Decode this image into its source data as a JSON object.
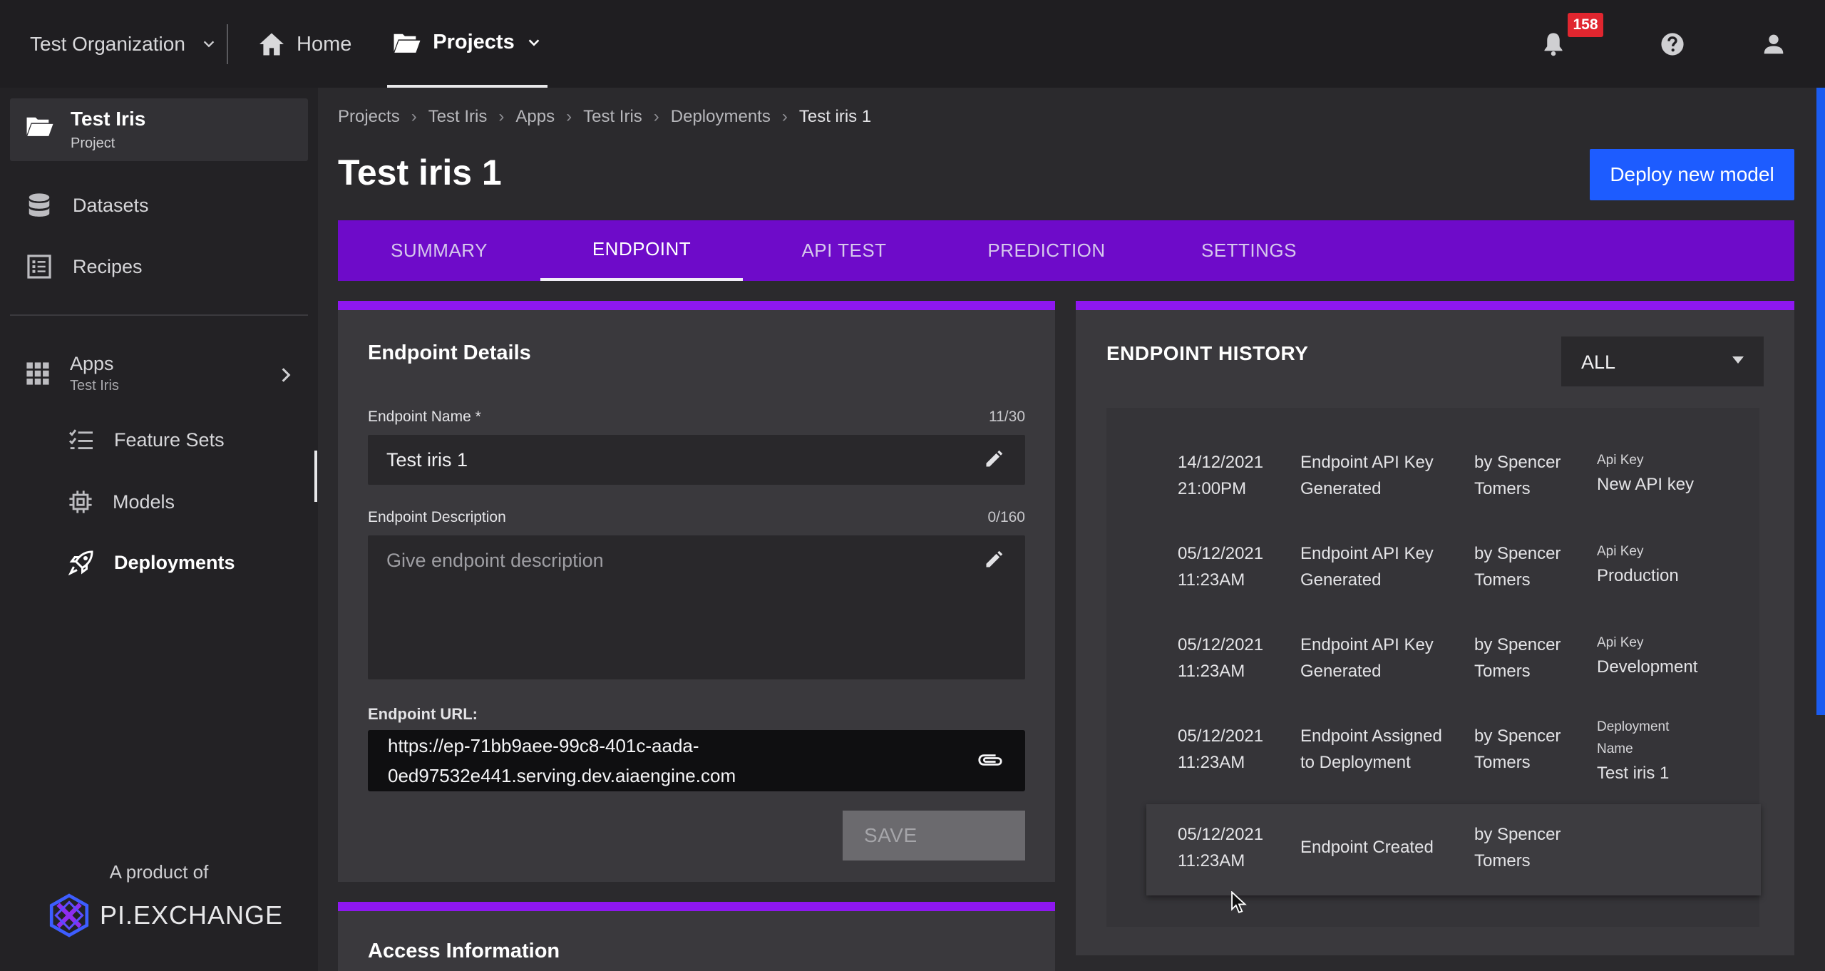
{
  "topbar": {
    "org_name": "Test Organization",
    "home_label": "Home",
    "projects_label": "Projects",
    "notification_count": "158"
  },
  "sidebar": {
    "project_title": "Test Iris",
    "project_sub": "Project",
    "datasets": "Datasets",
    "recipes": "Recipes",
    "apps_title": "Apps",
    "apps_sub": "Test Iris",
    "feature_sets": "Feature Sets",
    "models": "Models",
    "deployments": "Deployments",
    "product_of": "A product of",
    "brand": "PI.EXCHANGE"
  },
  "breadcrumb": [
    "Projects",
    "Test Iris",
    "Apps",
    "Test Iris",
    "Deployments",
    "Test iris 1"
  ],
  "page": {
    "title": "Test iris 1",
    "deploy_button": "Deploy new model"
  },
  "tabs": [
    "SUMMARY",
    "ENDPOINT",
    "API TEST",
    "PREDICTION",
    "SETTINGS"
  ],
  "endpoint": {
    "card_title": "Endpoint Details",
    "name_label": "Endpoint Name *",
    "name_count": "11/30",
    "name_value": "Test iris 1",
    "desc_label": "Endpoint Description",
    "desc_count": "0/160",
    "desc_placeholder": "Give endpoint description",
    "url_label": "Endpoint URL:",
    "url_line1": "https://ep-71bb9aee-99c8-401c-aada-",
    "url_line2": "0ed97532e441.serving.dev.aiaengine.com",
    "save_label": "SAVE"
  },
  "access": {
    "card_title": "Access Information"
  },
  "history": {
    "title": "ENDPOINT HISTORY",
    "filter_value": "ALL",
    "rows": [
      {
        "date": "14/12/2021",
        "time": "21:00PM",
        "event1": "Endpoint API Key",
        "event2": "Generated",
        "by1": "by Spencer",
        "by2": "Tomers",
        "k1": "Api Key",
        "k2": "",
        "v": "New API key"
      },
      {
        "date": "05/12/2021",
        "time": "11:23AM",
        "event1": "Endpoint API Key",
        "event2": "Generated",
        "by1": "by Spencer",
        "by2": "Tomers",
        "k1": "Api Key",
        "k2": "",
        "v": "Production"
      },
      {
        "date": "05/12/2021",
        "time": "11:23AM",
        "event1": "Endpoint API Key",
        "event2": "Generated",
        "by1": "by Spencer",
        "by2": "Tomers",
        "k1": "Api Key",
        "k2": "",
        "v": "Development"
      },
      {
        "date": "05/12/2021",
        "time": "11:23AM",
        "event1": "Endpoint Assigned",
        "event2": "to Deployment",
        "by1": "by Spencer",
        "by2": "Tomers",
        "k1": "Deployment",
        "k2": "Name",
        "v": "Test iris 1"
      },
      {
        "date": "05/12/2021",
        "time": "11:23AM",
        "event1": "Endpoint Created",
        "event2": "",
        "by1": "by Spencer",
        "by2": "Tomers",
        "k1": "",
        "k2": "",
        "v": ""
      }
    ]
  },
  "colors": {
    "accent_purple": "#8e17f0",
    "tab_bar": "#6e0bc9",
    "primary_blue": "#1d5cff",
    "badge_red": "#e0262f"
  }
}
